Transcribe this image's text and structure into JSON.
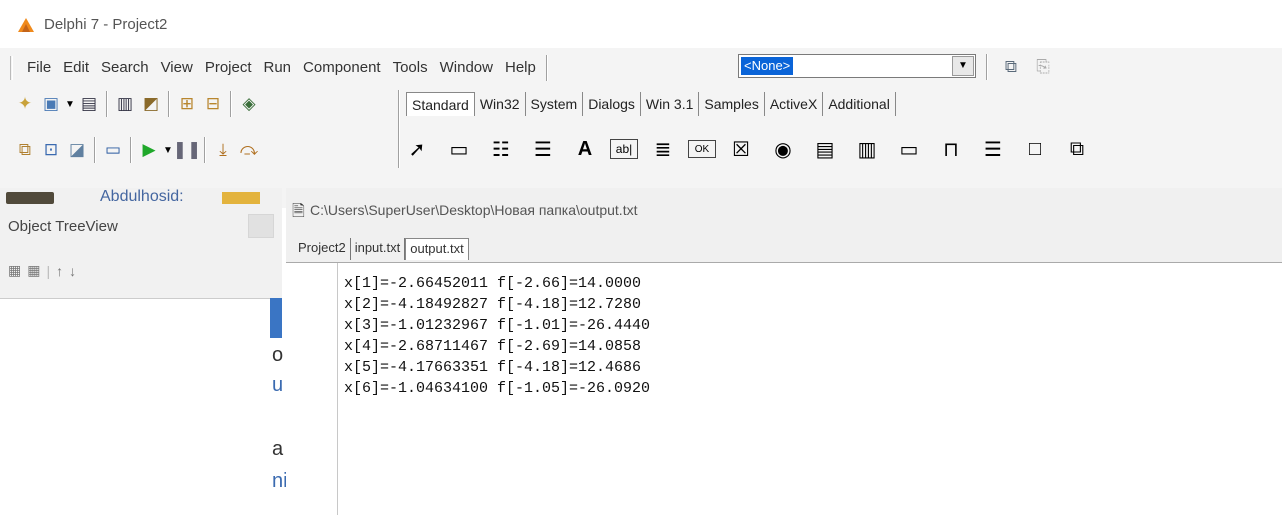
{
  "window": {
    "title": "Delphi 7 - Project2"
  },
  "menu": [
    "File",
    "Edit",
    "Search",
    "View",
    "Project",
    "Run",
    "Component",
    "Tools",
    "Window",
    "Help"
  ],
  "combo": {
    "value": "<None>"
  },
  "palette": {
    "tabs": [
      "Standard",
      "Win32",
      "System",
      "Dialogs",
      "Win 3.1",
      "Samples",
      "ActiveX",
      "Additional"
    ],
    "active_tab": "Standard"
  },
  "background_window": {
    "text": "Abdulhosid:"
  },
  "tree_view": {
    "title": "Object TreeView"
  },
  "background_form": {
    "chars": [
      "o",
      "u",
      "a",
      "ni"
    ]
  },
  "editor": {
    "path": "C:\\Users\\SuperUser\\Desktop\\Новая папка\\output.txt",
    "tabs": [
      "Project2",
      "input.txt",
      "output.txt"
    ],
    "active_tab": "output.txt",
    "lines": [
      "x[1]=-2.66452011 f[-2.66]=14.0000",
      "x[2]=-4.18492827 f[-4.18]=12.7280",
      "x[3]=-1.01232967 f[-1.01]=-26.4440",
      "x[4]=-2.68711467 f[-2.69]=14.0858",
      "x[5]=-4.17663351 f[-4.18]=12.4686",
      "x[6]=-1.04634100 f[-1.05]=-26.0920"
    ]
  },
  "colors": {
    "selection": "#0a64d8",
    "code_text": "#111111",
    "run_green": "#1fa82a"
  }
}
